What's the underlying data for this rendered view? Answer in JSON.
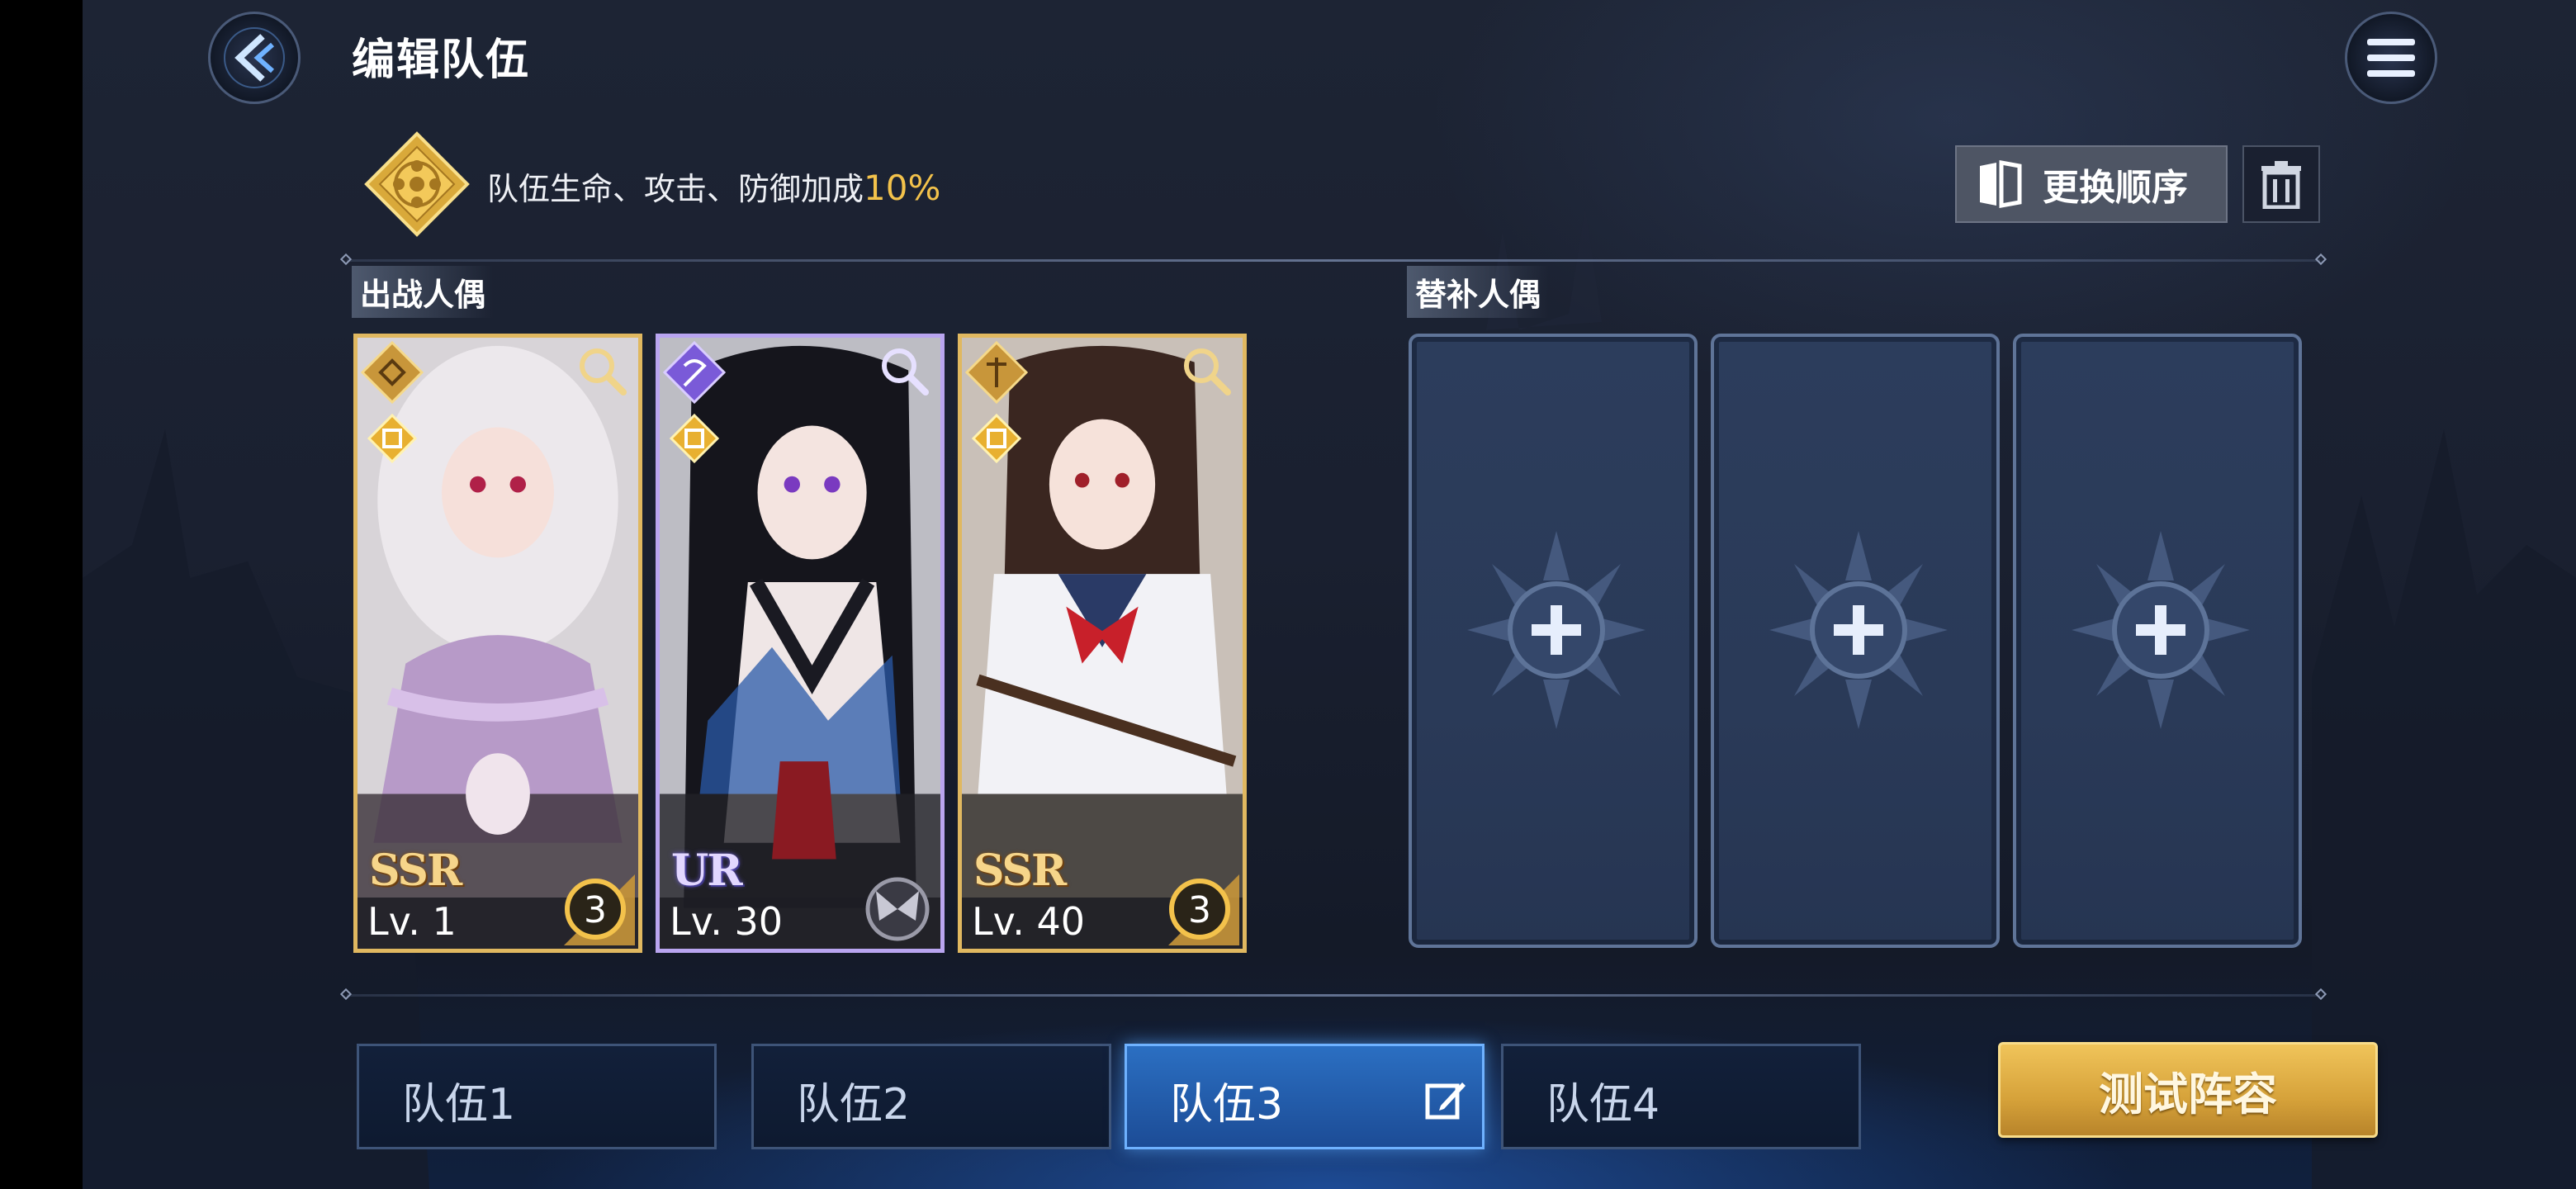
{
  "header": {
    "title": "编辑队伍",
    "back_icon": "back-arrow-icon",
    "menu_icon": "hamburger-menu-icon"
  },
  "bonus": {
    "icon": "golden-flower-emblem-icon",
    "text": "队伍生命、攻击、防御加成",
    "percent": "10%"
  },
  "toolbar": {
    "reorder_label": "更换顺序",
    "reorder_icon": "swap-order-icon",
    "delete_icon": "trash-icon"
  },
  "sections": {
    "active": "出战人偶",
    "substitute": "替补人偶"
  },
  "active_units": [
    {
      "rarity": "SSR",
      "level": "Lv.  1",
      "stars": "3",
      "frame": "gold"
    },
    {
      "rarity": "UR",
      "level": "Lv. 30",
      "stars": "",
      "frame": "violet"
    },
    {
      "rarity": "SSR",
      "level": "Lv. 40",
      "stars": "3",
      "frame": "gold"
    }
  ],
  "substitute_slots": [
    {
      "icon": "add-plus-icon"
    },
    {
      "icon": "add-plus-icon"
    },
    {
      "icon": "add-plus-icon"
    }
  ],
  "teams": [
    {
      "label": "队伍1",
      "active": false
    },
    {
      "label": "队伍2",
      "active": false
    },
    {
      "label": "队伍3",
      "active": true
    },
    {
      "label": "队伍4",
      "active": false
    }
  ],
  "test_button": {
    "label": "测试阵容"
  },
  "colors": {
    "accent_gold": "#f3c24b",
    "active_tab_blue": "#2b6fc2",
    "ur_violet": "#b9a5f0"
  }
}
